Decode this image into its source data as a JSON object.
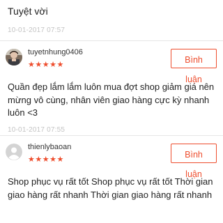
{
  "reviews": [
    {
      "content": "Tuyệt vời",
      "timestamp": "10-01-2017 07:57"
    },
    {
      "username": "tuyetnhung0406",
      "rating": "★★★★★",
      "comment_button": "Bình luận",
      "content": "Quần đẹp lắm lắm luôn mua đợt shop giảm giá nên mừng vô cùng, nhân viên giao hàng cực kỳ nhanh luôn <3",
      "timestamp": "10-01-2017 07:55"
    },
    {
      "username": "thienlybaoan",
      "rating": "★★★★★",
      "comment_button": "Bình luận",
      "content": "Shop phục vụ rất tốt Shop phục vụ rất tốt Thời gian giao hàng rất nhanh Thời gian giao hàng rất nhanh"
    }
  ],
  "colors": {
    "accent": "#ee4d2d",
    "timestamp": "#c4c4c4",
    "divider": "#e6e6e6"
  },
  "icons": {
    "review_1_avatar": "user-photo-avatar",
    "review_2_avatar": "default-user-avatar"
  }
}
